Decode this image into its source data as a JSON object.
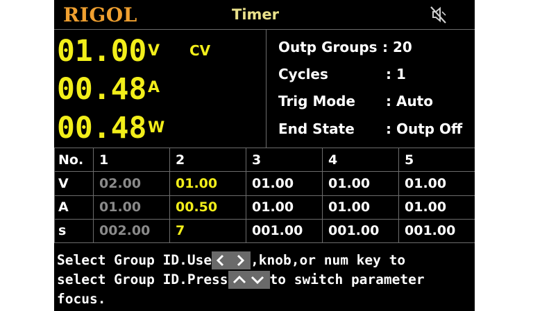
{
  "header": {
    "logo": "RIGOL",
    "title": "Timer",
    "mute_icon": "speaker-muted-icon"
  },
  "readings": {
    "voltage": "01.00",
    "voltage_unit": "V",
    "current": "00.48",
    "current_unit": "A",
    "power": "00.48",
    "power_unit": "W",
    "mode": "CV"
  },
  "settings": [
    {
      "name": "Outp Groups",
      "value": ": 20"
    },
    {
      "name": "Cycles",
      "value": ": 1"
    },
    {
      "name": "Trig Mode",
      "value": ": Auto"
    },
    {
      "name": "End State",
      "value": ": Outp Off"
    }
  ],
  "table": {
    "corner": "No.",
    "columns": [
      "1",
      "2",
      "3",
      "4",
      "5"
    ],
    "rows": [
      {
        "label": "V",
        "cells": [
          "02.00",
          "01.00",
          "01.00",
          "01.00",
          "01.00"
        ]
      },
      {
        "label": "A",
        "cells": [
          "01.00",
          "00.50",
          "01.00",
          "01.00",
          "01.00"
        ]
      },
      {
        "label": "s",
        "cells": [
          "002.00",
          "7",
          "001.00",
          "001.00",
          "001.00"
        ]
      }
    ]
  },
  "help": {
    "line1_a": "Select Group ID.Use",
    "line1_b": ",knob,or num key to",
    "line2_a": "select Group ID.Press",
    "line2_b": "to switch parameter",
    "line3": "focus.",
    "left_right_keys_icon": "left-right-arrows-icon",
    "up_down_keys_icon": "up-down-arrows-icon"
  },
  "colors": {
    "logo": "#f0a030",
    "title": "#e9e08a",
    "reading": "#f2ee1a",
    "dim": "#8a8a8a",
    "grid": "#6d6d6d"
  }
}
